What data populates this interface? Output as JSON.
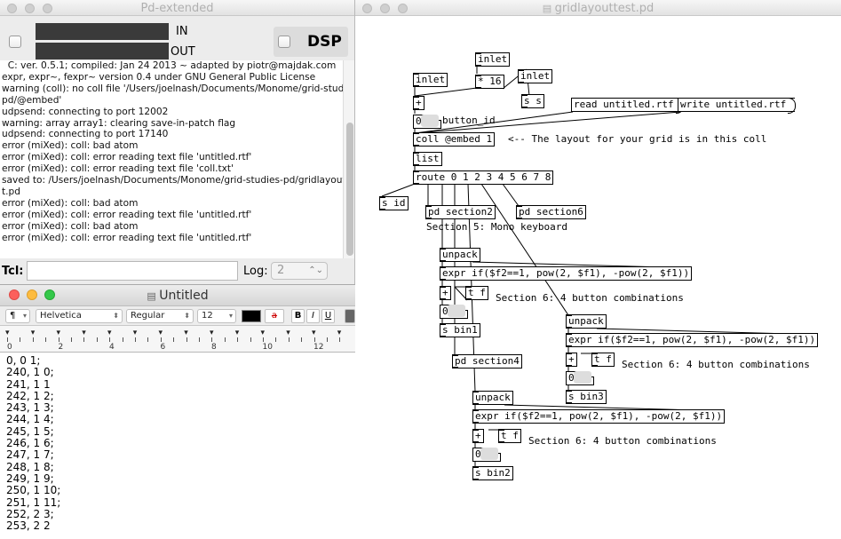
{
  "pd_window": {
    "title": "Pd-extended",
    "in_label": "IN",
    "out_label": "OUT",
    "dsp_label": "DSP",
    "console_lines": [
      "  C: ver. 0.5.1; compiled: Jan 24 2013 ~ adapted by piotr@majdak.com",
      "expr, expr~, fexpr~ version 0.4 under GNU General Public License",
      "warning (coll): no coll file '/Users/joelnash/Documents/Monome/grid-studies-",
      "pd/@embed'",
      "udpsend: connecting to port 12002",
      "warning: array array1: clearing save-in-patch flag",
      "udpsend: connecting to port 17140",
      "error (miXed): coll: bad atom",
      "error (miXed): coll: error reading text file 'untitled.rtf'",
      "error (miXed): coll: error reading text file 'coll.txt'",
      "saved to: /Users/joelnash/Documents/Monome/grid-studies-pd/gridlayouttes",
      "t.pd",
      "error (miXed): coll: bad atom",
      "error (miXed): coll: error reading text file 'untitled.rtf'",
      "error (miXed): coll: bad atom",
      "error (miXed): coll: error reading text file 'untitled.rtf'"
    ],
    "tcl_label": "Tcl:",
    "tcl_value": "",
    "log_label": "Log:",
    "log_value": "2"
  },
  "editor": {
    "title": "Untitled",
    "paragraph_style": "¶",
    "font_family": "Helvetica",
    "font_style": "Regular",
    "font_size": "12",
    "bold": "B",
    "italic": "I",
    "underline": "U",
    "text_color_swatch": "#000000",
    "ruler_numbers": [
      "0",
      "2",
      "4",
      "6",
      "8",
      "10",
      "12"
    ],
    "lines": [
      "0, 0 1;",
      "240, 1 0;",
      "241, 1 1",
      "242, 1 2;",
      "243, 1 3;",
      "244, 1 4;",
      "245, 1 5;",
      "246, 1 6;",
      "247, 1 7;",
      "248, 1 8;",
      "249, 1 9;",
      "250, 1 10;",
      "251, 1 11;",
      "252, 2 3;",
      "253, 2 2"
    ]
  },
  "patch": {
    "title": "gridlayouttest.pd",
    "objects": {
      "inlet_a": "inlet",
      "inlet_b": "inlet",
      "inlet_c": "inlet",
      "mult": "* 16",
      "plus_top": "+",
      "send_s": "s s",
      "coll": "coll @embed 1",
      "list": "list",
      "route": "route 0 1 2 3 4 5 6 7 8",
      "send_id": "s id",
      "pd_section2": "pd section2",
      "pd_section6": "pd section6",
      "unpack_1": "unpack",
      "expr_1": "expr if($f2==1, pow(2, $f1), -pow(2, $f1))",
      "plus_1": "+",
      "tf_1": "t f",
      "send_bin1": "s bin1",
      "pd_section4": "pd section4",
      "unpack_2": "unpack",
      "expr_2": "expr if($f2==1, pow(2, $f1), -pow(2, $f1))",
      "plus_2": "+",
      "tf_2": "t f",
      "send_bin3": "s bin3",
      "unpack_3": "unpack",
      "expr_3": "expr if($f2==1, pow(2, $f1), -pow(2, $f1))",
      "plus_3": "+",
      "tf_3": "t f",
      "send_bin2": "s bin2"
    },
    "messages": {
      "read": "read untitled.rtf",
      "write": "write untitled.rtf"
    },
    "numbers": {
      "num_top": "0",
      "num_1": "0",
      "num_2": "0",
      "num_3": "0"
    },
    "comments": {
      "button_id": "button_id",
      "layout_note": "<-- The layout for your grid is in this coll",
      "section5": "Section 5: Mono keyboard",
      "section6_a": "Section 6: 4 button combinations",
      "section6_b": "Section 6: 4 button combinations",
      "section6_c": "Section 6: 4 button combinations"
    }
  },
  "colors": {
    "close": "#fc605c",
    "minimize": "#fdbc40",
    "zoom": "#34c84a",
    "meter": "#3a3a3a"
  }
}
